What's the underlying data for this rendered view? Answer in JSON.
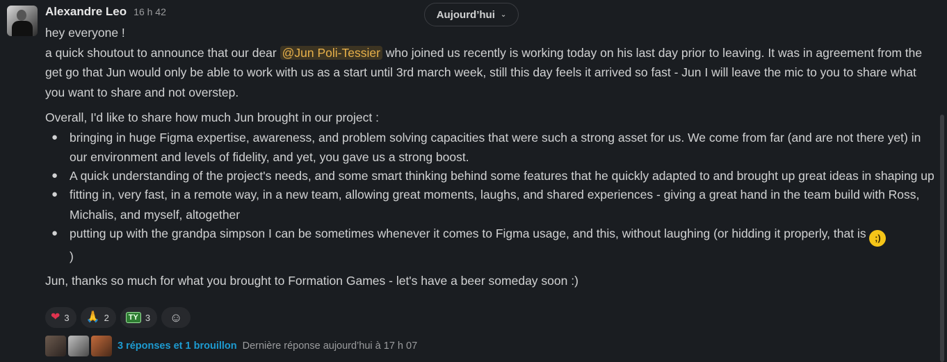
{
  "message": {
    "author": "Alexandre Leo",
    "time": "16 h 42",
    "date_divider": "Aujourd’hui",
    "line1": "hey everyone !",
    "p2_before": "a quick shoutout to announce that our dear ",
    "mention": "@Jun Poli-Tessier",
    "p2_after": " who joined us recently is working today on his last day prior to leaving. It was in agreement from the get go that Jun would only be able to work with us as a start until 3rd march week, still this day feels it arrived so fast - Jun I will leave the mic to you to share what you want to share and not overstep.",
    "p3": "Overall, I'd like to share how much Jun brought in our project :",
    "bullets": [
      "bringing in huge Figma expertise, awareness, and problem solving capacities that were such a strong asset for us. We come from far (and are not there yet) in our environment and levels of fidelity, and yet, you gave us a strong boost.",
      "A quick understanding of the project's needs, and some smart thinking behind some features that he quickly adapted to and brought up great ideas in shaping up",
      "fitting in, very fast, in a remote way, in a new team, allowing great moments, laughs, and shared experiences -  giving a great hand in the team build with Ross, Michalis, and myself, altogether",
      "putting up with the grandpa simpson I can be sometimes whenever it comes to Figma usage, and this, without laughing (or hidding it properly, that is "
    ],
    "bullet4_end": ")",
    "closing": "Jun, thanks so much for what you brought to Formation Games - let's have a beer someday soon :)"
  },
  "reactions": [
    {
      "icon": "heart-emoji",
      "glyph": "❤",
      "count": "3"
    },
    {
      "icon": "pray-emoji",
      "glyph": "🙏",
      "count": "2"
    },
    {
      "icon": "ty-emoji",
      "glyph": "TY",
      "count": "3"
    }
  ],
  "add_reaction_icon": "add-reaction-icon",
  "thread": {
    "replies_label": "3 réponses et 1 brouillon",
    "last_reply": "Dernière réponse aujourd’hui à 17 h 07"
  },
  "colors": {
    "background": "#1a1d21",
    "text": "#d1d2d3",
    "mention_bg": "#3c3422",
    "mention_text": "#e8b14a",
    "link": "#1d9bd1"
  }
}
